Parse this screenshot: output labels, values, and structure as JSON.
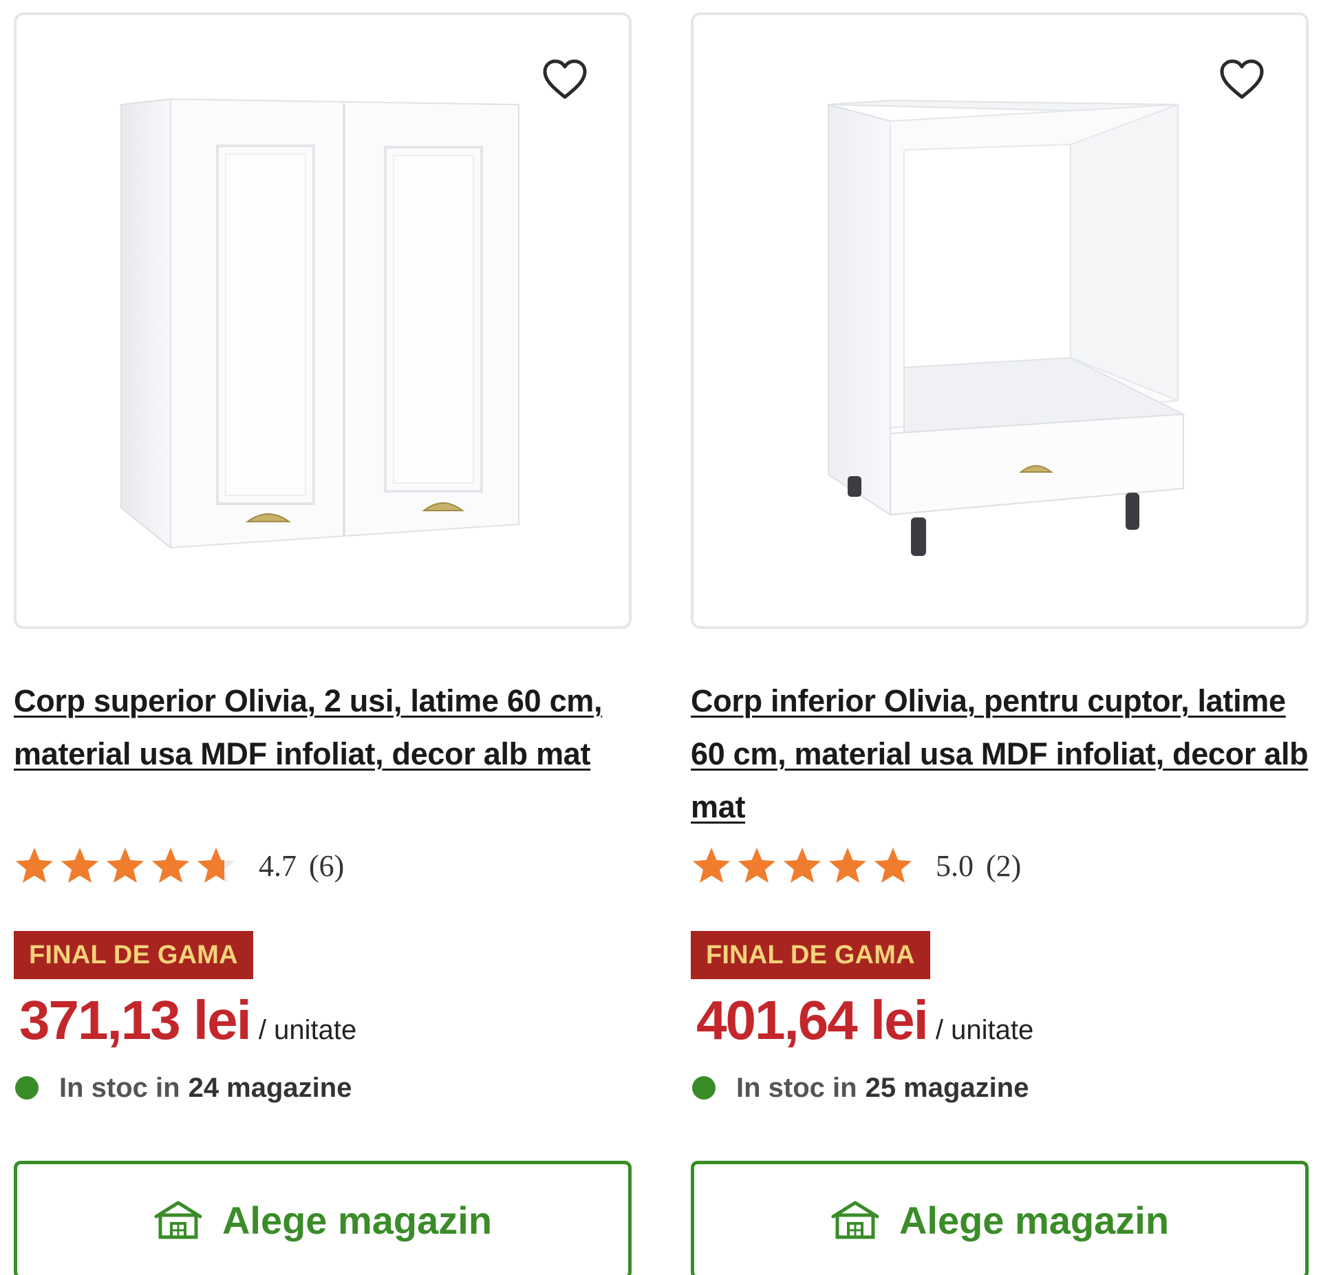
{
  "colors": {
    "price": "#c3272b",
    "badge_bg": "#a8241f",
    "badge_text": "#f4d37a",
    "stock_dot": "#3a8c28",
    "cta": "#3a8c28",
    "star": "#ef7d2d"
  },
  "products": [
    {
      "title": "Corp superior Olivia, 2 usi, latime 60 cm, material usa MDF infoliat, decor alb mat",
      "rating_value": "4.7",
      "rating_count": "(6)",
      "rating_stars": 4.7,
      "badge": "FINAL DE GAMA",
      "price": "371,13 lei",
      "unit": "/ unitate",
      "stock_prefix": "In stoc in",
      "stock_count": "24 magazine",
      "cta_label": "Alege magazin",
      "icons": {
        "favorite": "heart-outline-icon",
        "cta": "store-icon"
      }
    },
    {
      "title": "Corp inferior Olivia, pentru cuptor, latime 60 cm, material usa MDF infoliat, decor alb mat",
      "rating_value": "5.0",
      "rating_count": "(2)",
      "rating_stars": 5.0,
      "badge": "FINAL DE GAMA",
      "price": "401,64 lei",
      "unit": "/ unitate",
      "stock_prefix": "In stoc in",
      "stock_count": "25 magazine",
      "cta_label": "Alege magazin",
      "icons": {
        "favorite": "heart-outline-icon",
        "cta": "store-icon"
      }
    }
  ]
}
